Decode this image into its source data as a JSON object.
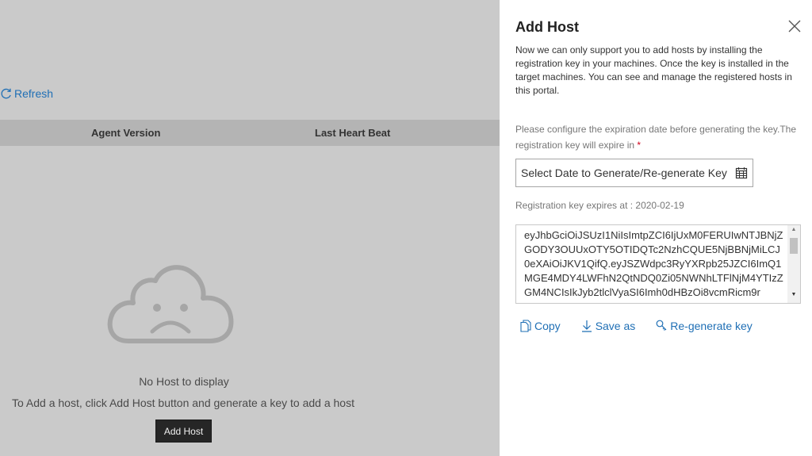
{
  "background": {
    "refresh_label": "Refresh",
    "columns": [
      "Agent Version",
      "Last Heart Beat"
    ],
    "empty_title": "No Host to display",
    "empty_hint": "To Add a host, click Add Host button and generate a key to add a host",
    "add_host_label": "Add Host"
  },
  "panel": {
    "title": "Add Host",
    "description": "Now we can only support you to add hosts by installing the registration key in your machines. Once the key is installed in the target machines. You can see and manage the registered hosts in this portal.",
    "config_text": "Please configure the expiration date before generating the key.The registration key will expire in",
    "required_mark": "*",
    "date_placeholder": "Select Date to Generate/Re-generate Key",
    "expires_text": "Registration key expires at : 2020-02-19",
    "key_text": "eyJhbGciOiJSUzI1NiIsImtpZCI6IjUxM0FERUIwNTJBNjZGODY3OUUxOTY5OTIDQTc2NzhCQUE5NjBBNjMiLCJ0eXAiOiJKV1QifQ.eyJSZWdpc3RyYXRpb25JZCI6ImQ1MGE4MDY4LWFhN2QtNDQ0Zi05NWNhLTFlNjM4YTIzZGM4NCIsIkJyb2tlclVyaSI6Imh0dHBzOi8vcmRicm9r",
    "actions": {
      "copy": "Copy",
      "save_as": "Save as",
      "regenerate": "Re-generate key"
    }
  },
  "colors": {
    "link": "#1f6fb5",
    "overlay": "#cacaca",
    "table_header": "#b4b4b4",
    "required": "#d0021b"
  },
  "icons": [
    "refresh-icon",
    "sad-cloud-icon",
    "close-icon",
    "calendar-icon",
    "copy-icon",
    "download-icon",
    "regenerate-key-icon"
  ]
}
